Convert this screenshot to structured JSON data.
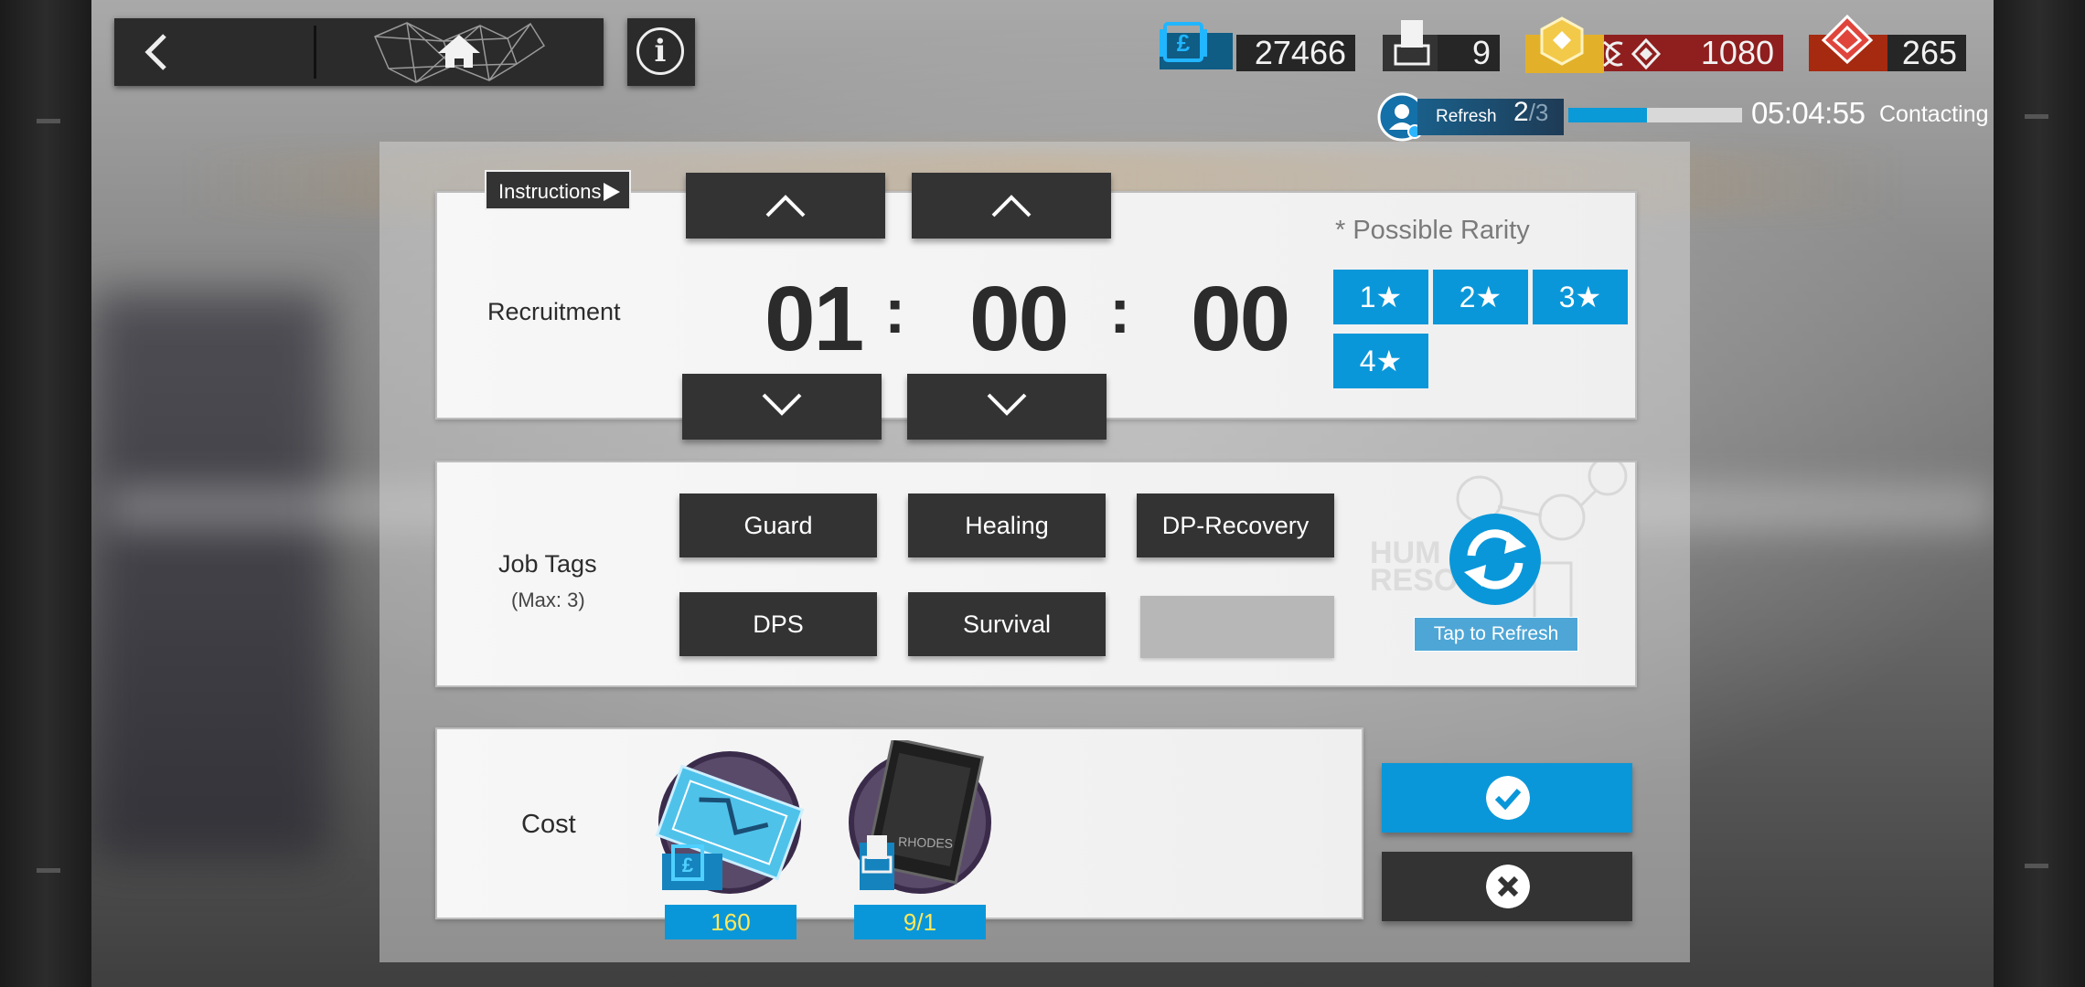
{
  "topbar": {
    "resources": [
      {
        "name": "lmd",
        "value": "27466"
      },
      {
        "name": "recruitment-permit",
        "value": "9"
      },
      {
        "name": "originite-prime",
        "value": "1080"
      },
      {
        "name": "orundum",
        "value": "265"
      }
    ],
    "refresh": {
      "label": "Refresh",
      "current": "2",
      "total": "/3",
      "progress": 0.45,
      "timer": "05:04:55",
      "status": "Contacting"
    }
  },
  "recruit": {
    "instructions_label": "Instructions",
    "recruitment_label": "Recruitment",
    "time": {
      "hours": "01",
      "minutes": "00",
      "seconds": "00",
      "sep": ":"
    },
    "rarity_title": "* Possible Rarity",
    "rarities": [
      "1★",
      "2★",
      "3★",
      "4★"
    ],
    "job_tags_label": "Job Tags",
    "job_tags_sub": "(Max: 3)",
    "tags": [
      "Guard",
      "Healing",
      "DP-Recovery",
      "DPS",
      "Survival"
    ],
    "tap_refresh_label": "Tap to Refresh",
    "cost_label": "Cost",
    "costs": [
      {
        "item": "lmd-ticket",
        "amount": "160"
      },
      {
        "item": "recruitment-permit",
        "amount": "9/1"
      }
    ]
  },
  "colors": {
    "accent": "#0a97d9",
    "dark_button": "#333333",
    "cost_text": "#ffe85a"
  }
}
